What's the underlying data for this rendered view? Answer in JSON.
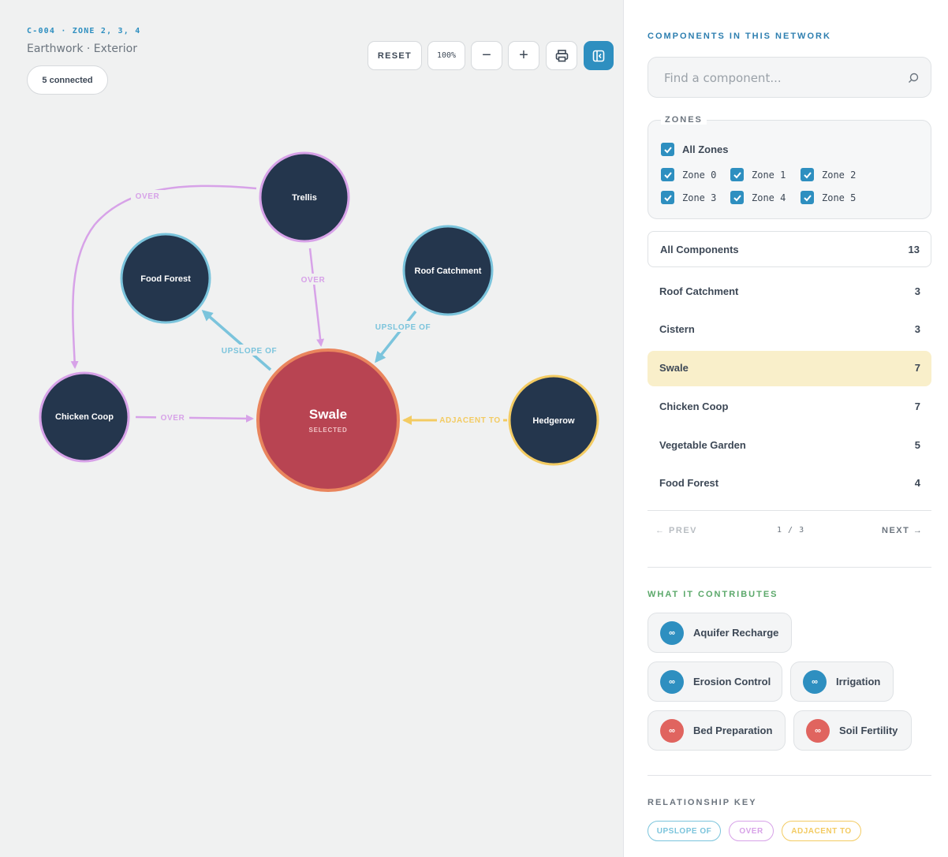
{
  "header": {
    "code": "C-004 · ZONE 2, 3, 4",
    "subtitle": "Earthwork · Exterior",
    "connected": "5 connected"
  },
  "toolbar": {
    "reset_label": "RESET",
    "zoom_label": "100%",
    "zoom_out_label": "−",
    "zoom_in_label": "+",
    "print_icon": "printer-icon",
    "panel_icon": "panel-toggle-icon"
  },
  "graph": {
    "nodes": [
      {
        "id": "trellis",
        "label": "Trellis",
        "ring": "#d7a2e8"
      },
      {
        "id": "food-forest",
        "label": "Food Forest",
        "ring": "#7bc4dc"
      },
      {
        "id": "roof-catchment",
        "label": "Roof Catchment",
        "ring": "#7bc4dc"
      },
      {
        "id": "chicken-coop",
        "label": "Chicken Coop",
        "ring": "#d7a2e8"
      },
      {
        "id": "hedgerow",
        "label": "Hedgerow",
        "ring": "#f3cb62"
      }
    ],
    "center": {
      "label": "Swale",
      "sublabel": "SELECTED",
      "fill": "#b84452",
      "ring": "#e9855d"
    },
    "edges": [
      {
        "label": "OVER",
        "color": "#d7a2e8"
      },
      {
        "label": "OVER",
        "color": "#d7a2e8"
      },
      {
        "label": "UPSLOPE OF",
        "color": "#7bc4dc"
      },
      {
        "label": "UPSLOPE OF",
        "color": "#7bc4dc"
      },
      {
        "label": "OVER",
        "color": "#d7a2e8"
      },
      {
        "label": "ADJACENT TO",
        "color": "#f3cb62"
      }
    ]
  },
  "sidebar": {
    "title": "COMPONENTS IN THIS NETWORK",
    "search_placeholder": "Find a component...",
    "zones_title": "ZONES",
    "all_zones": "All Zones",
    "zones": [
      "Zone 0",
      "Zone 1",
      "Zone 2",
      "Zone 3",
      "Zone 4",
      "Zone 5"
    ],
    "all_components": {
      "label": "All Components",
      "count": "13"
    },
    "components": [
      {
        "label": "Roof Catchment",
        "count": "3"
      },
      {
        "label": "Cistern",
        "count": "3"
      },
      {
        "label": "Swale",
        "count": "7"
      },
      {
        "label": "Chicken Coop",
        "count": "7"
      },
      {
        "label": "Vegetable Garden",
        "count": "5"
      },
      {
        "label": "Food Forest",
        "count": "4"
      }
    ],
    "pager": {
      "prev": "← PREV",
      "page": "1 / 3",
      "next": "NEXT →"
    },
    "contributes_title": "WHAT IT CONTRIBUTES",
    "contributes": [
      {
        "label": "Aquifer Recharge",
        "color": "#2e8fc0"
      },
      {
        "label": "Erosion Control",
        "color": "#2e8fc0"
      },
      {
        "label": "Irrigation",
        "color": "#2e8fc0"
      },
      {
        "label": "Bed Preparation",
        "color": "#e0645f"
      },
      {
        "label": "Soil Fertility",
        "color": "#e0645f"
      }
    ],
    "key_title": "RELATIONSHIP KEY",
    "keys": [
      {
        "label": "UPSLOPE OF",
        "color": "#7bc4dc"
      },
      {
        "label": "OVER",
        "color": "#d7a2e8"
      },
      {
        "label": "ADJACENT TO",
        "color": "#f3cb62"
      }
    ]
  },
  "colors": {
    "accent": "#2e8fc0",
    "node_fill": "#24364d",
    "selected_row": "#f9efca"
  }
}
